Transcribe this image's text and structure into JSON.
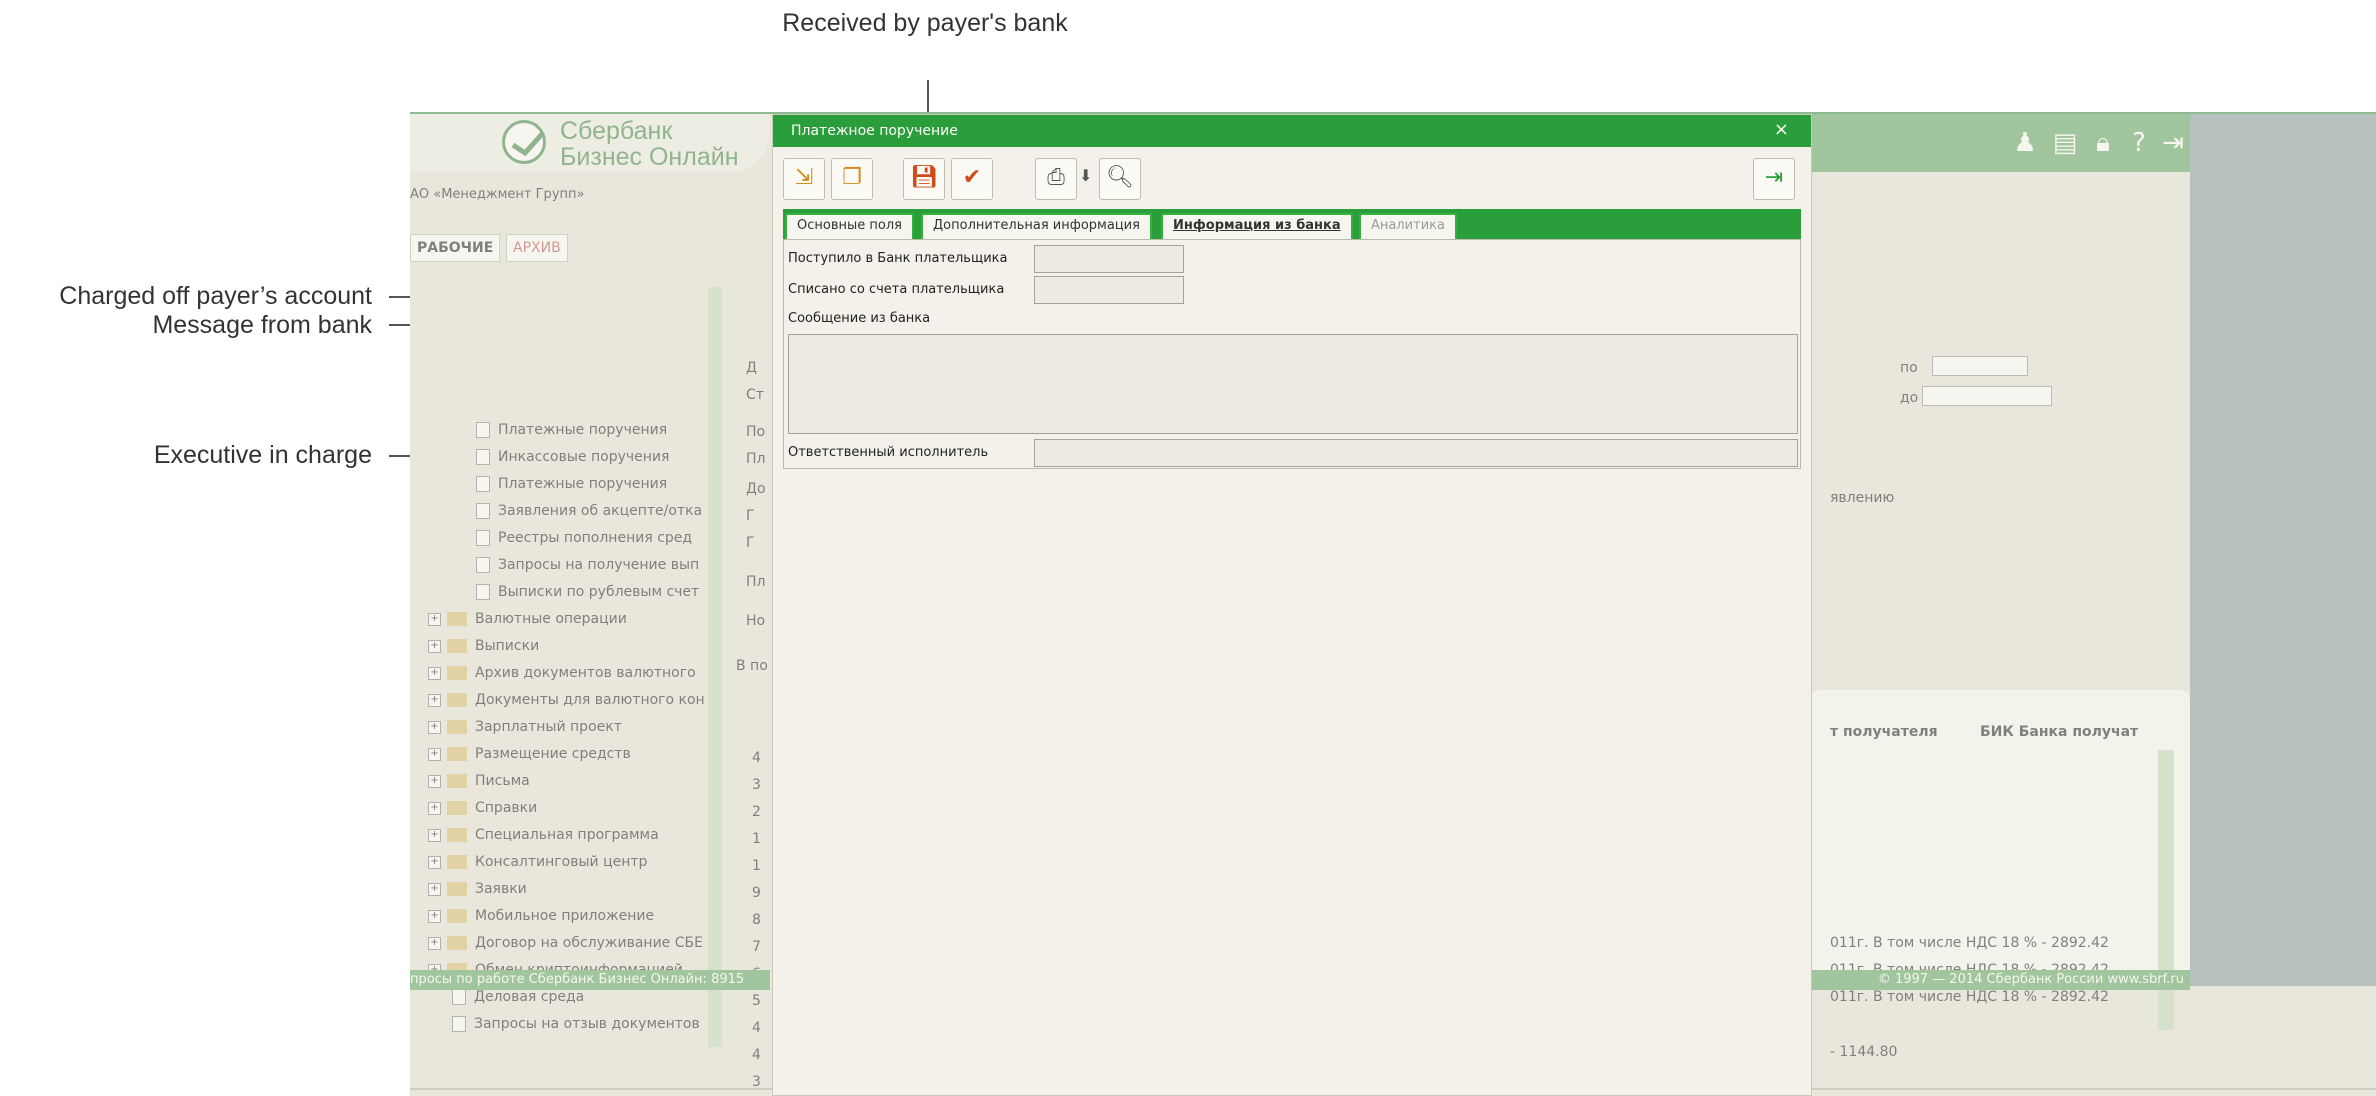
{
  "annotations": {
    "received_by_payer_bank": "Received by payer's bank",
    "charged_off_payer_account": "Charged off payer’s account",
    "message_from_bank": "Message from bank",
    "executive_in_charge": "Executive in charge"
  },
  "background": {
    "logo_line1": "Сбербанк",
    "logo_line2": "Бизнес Онлайн",
    "company": "АО «Менеджмент Групп»",
    "left_tabs": [
      "РАБОЧИЕ",
      "АРХИВ"
    ],
    "tree_docs": [
      "Платежные поручения",
      "Инкассовые поручения",
      "Платежные поручения",
      "Заявления об акцепте/отка",
      "Реестры пополнения сред",
      "Запросы на получение вып",
      "Выписки по рублевым счет"
    ],
    "tree_folders": [
      "Валютные операции",
      "Выписки",
      "Архив документов валютного",
      "Документы для валютного кон",
      "Зарплатный проект",
      "Размещение средств",
      "Письма",
      "Справки",
      "Специальная программа",
      "Консалтинговый центр",
      "Заявки",
      "Мобильное приложение",
      "Договор на обслуживание СБЕ",
      "Обмен криптоинформацией"
    ],
    "tree_tail": [
      "Деловая среда",
      "Запросы на отзыв документов"
    ],
    "filter_po": "по",
    "filter_do": "до",
    "partial_text": "явлению",
    "column_headers": [
      "т получателя",
      "БИК Банка получат"
    ],
    "row_texts": [
      "011г. В том числе НДС 18 % - 2892.42",
      "011г. В том числе НДС 18 % - 2892.42",
      "011г. В том числе НДС 18 % - 2892.42",
      "- 1144.80"
    ],
    "left_numbers": [
      "4",
      "3",
      "2",
      "1",
      "1",
      "9",
      "8",
      "7",
      "6",
      "5",
      "4",
      "4",
      "3"
    ],
    "status_left": "просы по работе Сбербанк Бизнес Онлайн: 8915",
    "status_right": "© 1997 — 2014 Сбербанк России  www.sbrf.ru",
    "list_left_labels": [
      "Д",
      "Ст",
      "По",
      "Пл",
      "До",
      "Г",
      "Г",
      "Пл",
      "Но"
    ],
    "search_left": "В по"
  },
  "dialog": {
    "title": "Платежное поручение",
    "close": "×",
    "tabs": [
      {
        "label": "Основные поля",
        "state": "normal"
      },
      {
        "label": "Дополнительная информация",
        "state": "normal"
      },
      {
        "label": "Информация из банка",
        "state": "active"
      },
      {
        "label": "Аналитика",
        "state": "disabled"
      }
    ],
    "fields": {
      "received_label": "Поступило в Банк плательщика",
      "received_value": "",
      "charged_label": "Списано со счета плательщика",
      "charged_value": "",
      "message_label": "Сообщение из банка",
      "message_value": "",
      "executive_label": "Ответственный исполнитель",
      "executive_value": ""
    }
  },
  "colors": {
    "accent_green": "#2a9e3a",
    "header_green": "#6cae6f",
    "dialog_bg": "#f3f1ea"
  }
}
